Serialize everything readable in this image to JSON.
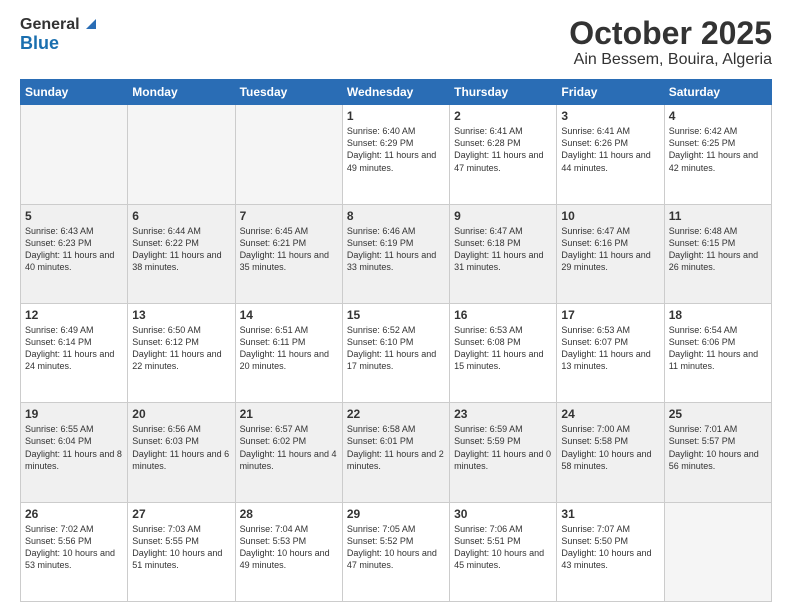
{
  "header": {
    "logo_general": "General",
    "logo_blue": "Blue",
    "title": "October 2025",
    "subtitle": "Ain Bessem, Bouira, Algeria"
  },
  "weekdays": [
    "Sunday",
    "Monday",
    "Tuesday",
    "Wednesday",
    "Thursday",
    "Friday",
    "Saturday"
  ],
  "weeks": [
    [
      {
        "day": "",
        "info": ""
      },
      {
        "day": "",
        "info": ""
      },
      {
        "day": "",
        "info": ""
      },
      {
        "day": "1",
        "info": "Sunrise: 6:40 AM\nSunset: 6:29 PM\nDaylight: 11 hours\nand 49 minutes."
      },
      {
        "day": "2",
        "info": "Sunrise: 6:41 AM\nSunset: 6:28 PM\nDaylight: 11 hours\nand 47 minutes."
      },
      {
        "day": "3",
        "info": "Sunrise: 6:41 AM\nSunset: 6:26 PM\nDaylight: 11 hours\nand 44 minutes."
      },
      {
        "day": "4",
        "info": "Sunrise: 6:42 AM\nSunset: 6:25 PM\nDaylight: 11 hours\nand 42 minutes."
      }
    ],
    [
      {
        "day": "5",
        "info": "Sunrise: 6:43 AM\nSunset: 6:23 PM\nDaylight: 11 hours\nand 40 minutes."
      },
      {
        "day": "6",
        "info": "Sunrise: 6:44 AM\nSunset: 6:22 PM\nDaylight: 11 hours\nand 38 minutes."
      },
      {
        "day": "7",
        "info": "Sunrise: 6:45 AM\nSunset: 6:21 PM\nDaylight: 11 hours\nand 35 minutes."
      },
      {
        "day": "8",
        "info": "Sunrise: 6:46 AM\nSunset: 6:19 PM\nDaylight: 11 hours\nand 33 minutes."
      },
      {
        "day": "9",
        "info": "Sunrise: 6:47 AM\nSunset: 6:18 PM\nDaylight: 11 hours\nand 31 minutes."
      },
      {
        "day": "10",
        "info": "Sunrise: 6:47 AM\nSunset: 6:16 PM\nDaylight: 11 hours\nand 29 minutes."
      },
      {
        "day": "11",
        "info": "Sunrise: 6:48 AM\nSunset: 6:15 PM\nDaylight: 11 hours\nand 26 minutes."
      }
    ],
    [
      {
        "day": "12",
        "info": "Sunrise: 6:49 AM\nSunset: 6:14 PM\nDaylight: 11 hours\nand 24 minutes."
      },
      {
        "day": "13",
        "info": "Sunrise: 6:50 AM\nSunset: 6:12 PM\nDaylight: 11 hours\nand 22 minutes."
      },
      {
        "day": "14",
        "info": "Sunrise: 6:51 AM\nSunset: 6:11 PM\nDaylight: 11 hours\nand 20 minutes."
      },
      {
        "day": "15",
        "info": "Sunrise: 6:52 AM\nSunset: 6:10 PM\nDaylight: 11 hours\nand 17 minutes."
      },
      {
        "day": "16",
        "info": "Sunrise: 6:53 AM\nSunset: 6:08 PM\nDaylight: 11 hours\nand 15 minutes."
      },
      {
        "day": "17",
        "info": "Sunrise: 6:53 AM\nSunset: 6:07 PM\nDaylight: 11 hours\nand 13 minutes."
      },
      {
        "day": "18",
        "info": "Sunrise: 6:54 AM\nSunset: 6:06 PM\nDaylight: 11 hours\nand 11 minutes."
      }
    ],
    [
      {
        "day": "19",
        "info": "Sunrise: 6:55 AM\nSunset: 6:04 PM\nDaylight: 11 hours\nand 8 minutes."
      },
      {
        "day": "20",
        "info": "Sunrise: 6:56 AM\nSunset: 6:03 PM\nDaylight: 11 hours\nand 6 minutes."
      },
      {
        "day": "21",
        "info": "Sunrise: 6:57 AM\nSunset: 6:02 PM\nDaylight: 11 hours\nand 4 minutes."
      },
      {
        "day": "22",
        "info": "Sunrise: 6:58 AM\nSunset: 6:01 PM\nDaylight: 11 hours\nand 2 minutes."
      },
      {
        "day": "23",
        "info": "Sunrise: 6:59 AM\nSunset: 5:59 PM\nDaylight: 11 hours\nand 0 minutes."
      },
      {
        "day": "24",
        "info": "Sunrise: 7:00 AM\nSunset: 5:58 PM\nDaylight: 10 hours\nand 58 minutes."
      },
      {
        "day": "25",
        "info": "Sunrise: 7:01 AM\nSunset: 5:57 PM\nDaylight: 10 hours\nand 56 minutes."
      }
    ],
    [
      {
        "day": "26",
        "info": "Sunrise: 7:02 AM\nSunset: 5:56 PM\nDaylight: 10 hours\nand 53 minutes."
      },
      {
        "day": "27",
        "info": "Sunrise: 7:03 AM\nSunset: 5:55 PM\nDaylight: 10 hours\nand 51 minutes."
      },
      {
        "day": "28",
        "info": "Sunrise: 7:04 AM\nSunset: 5:53 PM\nDaylight: 10 hours\nand 49 minutes."
      },
      {
        "day": "29",
        "info": "Sunrise: 7:05 AM\nSunset: 5:52 PM\nDaylight: 10 hours\nand 47 minutes."
      },
      {
        "day": "30",
        "info": "Sunrise: 7:06 AM\nSunset: 5:51 PM\nDaylight: 10 hours\nand 45 minutes."
      },
      {
        "day": "31",
        "info": "Sunrise: 7:07 AM\nSunset: 5:50 PM\nDaylight: 10 hours\nand 43 minutes."
      },
      {
        "day": "",
        "info": ""
      }
    ]
  ]
}
